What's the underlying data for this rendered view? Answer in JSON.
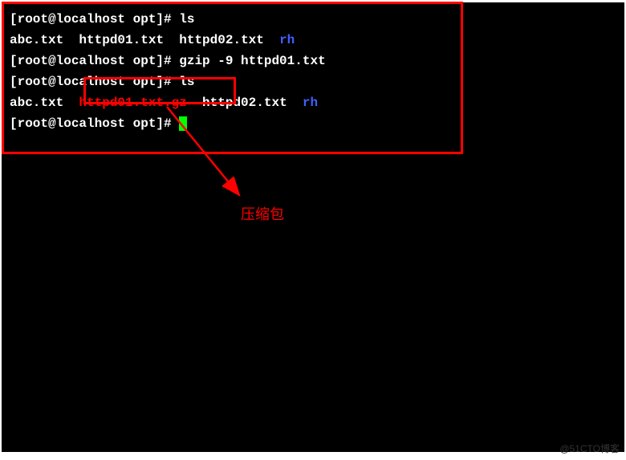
{
  "terminal": {
    "lines": [
      {
        "prompt": "[root@localhost opt]# ",
        "cmd": "ls"
      },
      {
        "files": [
          {
            "name": "abc.txt",
            "type": "file"
          },
          {
            "name": "httpd01.txt",
            "type": "file"
          },
          {
            "name": "httpd02.txt",
            "type": "file"
          },
          {
            "name": "rh",
            "type": "dir"
          }
        ]
      },
      {
        "prompt": "[root@localhost opt]# ",
        "cmd": "gzip -9 httpd01.txt"
      },
      {
        "prompt": "[root@localhost opt]# ",
        "cmd": "ls"
      },
      {
        "files": [
          {
            "name": "abc.txt",
            "type": "file"
          },
          {
            "name": "httpd01.txt.gz",
            "type": "gz"
          },
          {
            "name": "httpd02.txt",
            "type": "file"
          },
          {
            "name": "rh",
            "type": "dir"
          }
        ]
      },
      {
        "prompt": "[root@localhost opt]# ",
        "cmd": ""
      }
    ]
  },
  "annotation": {
    "label": "压缩包"
  },
  "watermark": "@51CTO博客"
}
